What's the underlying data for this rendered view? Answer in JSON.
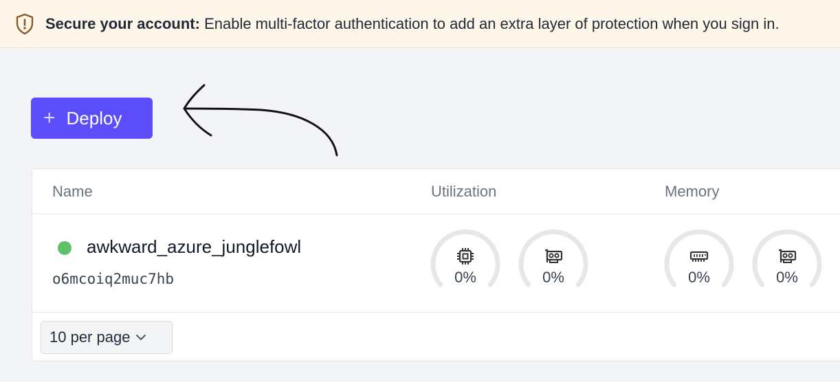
{
  "banner": {
    "title": "Secure your account:",
    "message": " Enable multi-factor authentication to add an extra layer of protection when you sign in."
  },
  "toolbar": {
    "deploy_label": "Deploy"
  },
  "table": {
    "columns": [
      "Name",
      "Utilization",
      "Memory"
    ],
    "rows": [
      {
        "status": "running",
        "name": "awkward_azure_junglefowl",
        "id": "o6mcoiq2muc7hb",
        "utilization": {
          "cpu": "0%",
          "gpu": "0%"
        },
        "memory": {
          "ram": "0%",
          "vram": "0%"
        }
      }
    ]
  },
  "pagination": {
    "per_page_label": "10 per page"
  },
  "colors": {
    "accent": "#5b4dfa",
    "status_running": "#5cc169",
    "banner_bg": "#fdf6e9"
  },
  "icons": [
    "shield-warning-icon",
    "plus-icon",
    "cpu-icon",
    "gpu-card-icon",
    "memory-icon",
    "chevron-down-icon"
  ]
}
